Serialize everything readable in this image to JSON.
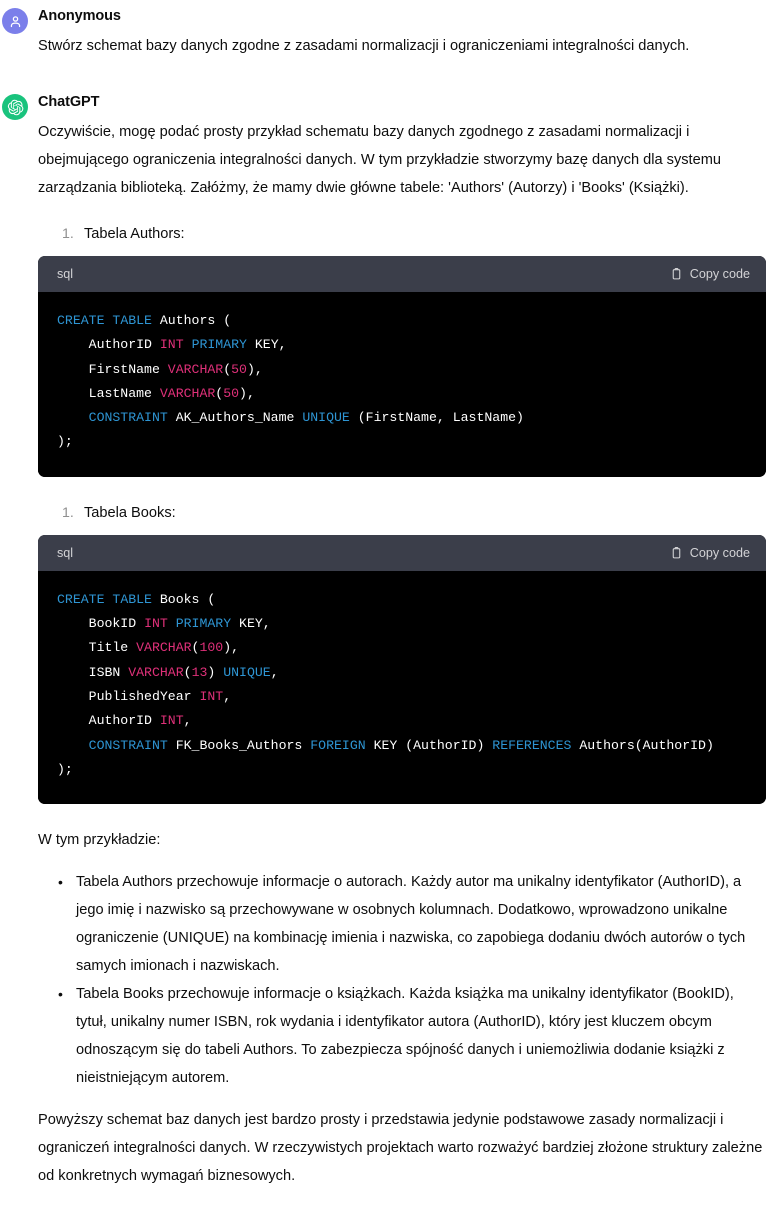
{
  "conversation": {
    "user": {
      "author": "Anonymous",
      "avatar_icon": "person-icon",
      "message": "Stwórz schemat bazy danych zgodne z zasadami normalizacji i ograniczeniami integralności danych."
    },
    "assistant": {
      "author": "ChatGPT",
      "avatar_icon": "openai-logo-icon",
      "intro": "Oczywiście, mogę podać prosty przykład schematu bazy danych zgodnego z zasadami normalizacji i obejmującego ograniczenia integralności danych. W tym przykładzie stworzymy bazę danych dla systemu zarządzania biblioteką. Załóżmy, że mamy dwie główne tabele: 'Authors' (Autorzy) i 'Books' (Książki).",
      "list_authors": {
        "marker": "1.",
        "text": "Tabela Authors:"
      },
      "list_books": {
        "marker": "1.",
        "text": "Tabela Books:"
      },
      "code_authors": {
        "language": "sql",
        "copy_label": "Copy code",
        "copy_icon": "clipboard-icon",
        "lines": [
          [
            [
              "kw",
              "CREATE"
            ],
            [
              "pln",
              " "
            ],
            [
              "kw",
              "TABLE"
            ],
            [
              "pln",
              " Authors ("
            ]
          ],
          [
            [
              "pln",
              "    AuthorID "
            ],
            [
              "typ",
              "INT"
            ],
            [
              "pln",
              " "
            ],
            [
              "kw",
              "PRIMARY"
            ],
            [
              "pln",
              " KEY,"
            ]
          ],
          [
            [
              "pln",
              "    FirstName "
            ],
            [
              "typ",
              "VARCHAR"
            ],
            [
              "pln",
              "("
            ],
            [
              "num",
              "50"
            ],
            [
              "pln",
              "),"
            ]
          ],
          [
            [
              "pln",
              "    LastName "
            ],
            [
              "typ",
              "VARCHAR"
            ],
            [
              "pln",
              "("
            ],
            [
              "num",
              "50"
            ],
            [
              "pln",
              "),"
            ]
          ],
          [
            [
              "pln",
              "    "
            ],
            [
              "kw",
              "CONSTRAINT"
            ],
            [
              "pln",
              " AK_Authors_Name "
            ],
            [
              "kw",
              "UNIQUE"
            ],
            [
              "pln",
              " (FirstName, LastName)"
            ]
          ],
          [
            [
              "pln",
              ");"
            ]
          ]
        ]
      },
      "code_books": {
        "language": "sql",
        "copy_label": "Copy code",
        "copy_icon": "clipboard-icon",
        "lines": [
          [
            [
              "kw",
              "CREATE"
            ],
            [
              "pln",
              " "
            ],
            [
              "kw",
              "TABLE"
            ],
            [
              "pln",
              " Books ("
            ]
          ],
          [
            [
              "pln",
              "    BookID "
            ],
            [
              "typ",
              "INT"
            ],
            [
              "pln",
              " "
            ],
            [
              "kw",
              "PRIMARY"
            ],
            [
              "pln",
              " KEY,"
            ]
          ],
          [
            [
              "pln",
              "    Title "
            ],
            [
              "typ",
              "VARCHAR"
            ],
            [
              "pln",
              "("
            ],
            [
              "num",
              "100"
            ],
            [
              "pln",
              "),"
            ]
          ],
          [
            [
              "pln",
              "    ISBN "
            ],
            [
              "typ",
              "VARCHAR"
            ],
            [
              "pln",
              "("
            ],
            [
              "num",
              "13"
            ],
            [
              "pln",
              ") "
            ],
            [
              "kw",
              "UNIQUE"
            ],
            [
              "pln",
              ","
            ]
          ],
          [
            [
              "pln",
              "    PublishedYear "
            ],
            [
              "typ",
              "INT"
            ],
            [
              "pln",
              ","
            ]
          ],
          [
            [
              "pln",
              "    AuthorID "
            ],
            [
              "typ",
              "INT"
            ],
            [
              "pln",
              ","
            ]
          ],
          [
            [
              "pln",
              "    "
            ],
            [
              "kw",
              "CONSTRAINT"
            ],
            [
              "pln",
              " FK_Books_Authors "
            ],
            [
              "kw",
              "FOREIGN"
            ],
            [
              "pln",
              " KEY (AuthorID) "
            ],
            [
              "kw",
              "REFERENCES"
            ],
            [
              "pln",
              " Authors(AuthorID)"
            ]
          ],
          [
            [
              "pln",
              ");"
            ]
          ]
        ]
      },
      "example_heading": "W tym przykładzie:",
      "bullets": [
        "Tabela Authors przechowuje informacje o autorach. Każdy autor ma unikalny identyfikator (AuthorID), a jego imię i nazwisko są przechowywane w osobnych kolumnach. Dodatkowo, wprowadzono unikalne ograniczenie (UNIQUE) na kombinację imienia i nazwiska, co zapobiega dodaniu dwóch autorów o tych samych imionach i nazwiskach.",
        "Tabela Books przechowuje informacje o książkach. Każda książka ma unikalny identyfikator (BookID), tytuł, unikalny numer ISBN, rok wydania i identyfikator autora (AuthorID), który jest kluczem obcym odnoszącym się do tabeli Authors. To zabezpiecza spójność danych i uniemożliwia dodanie książki z nieistniejącym autorem."
      ],
      "bullet_marker": "•",
      "closing": "Powyższy schemat baz danych jest bardzo prosty i przedstawia jedynie podstawowe zasady normalizacji i ograniczeń integralności danych. W rzeczywistych projektach warto rozważyć bardziej złożone struktury zależne od konkretnych wymagań biznesowych."
    }
  },
  "colors": {
    "user_avatar": "#7b7fea",
    "assistant_avatar": "#19c37d",
    "code_background": "#000000",
    "code_header_background": "#3b3e4a",
    "keyword": "#2e95d3",
    "type": "#df3079"
  }
}
